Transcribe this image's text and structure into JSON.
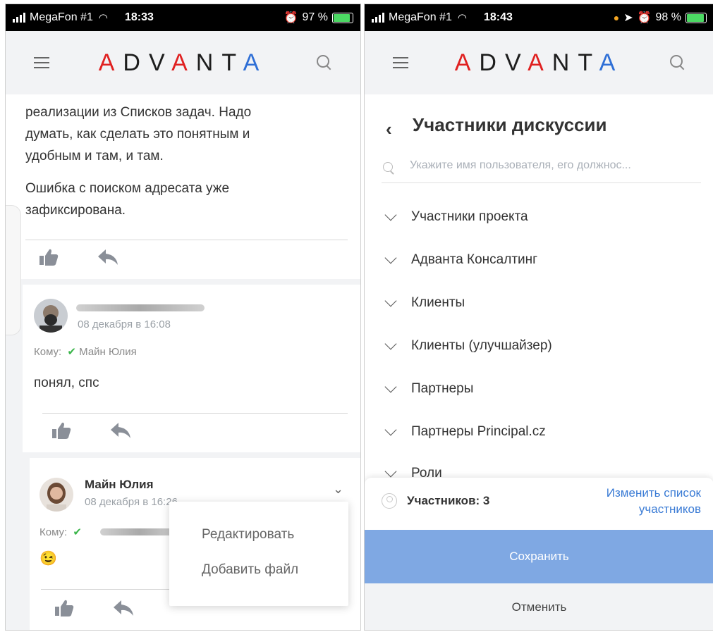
{
  "left_screen": {
    "status": {
      "carrier": "MegaFon #1",
      "time": "18:33",
      "battery": "97 %",
      "battery_level": 0.97
    },
    "logo": "ADVANTA",
    "comment1": {
      "text_lines": [
        "реализации из Списков задач. Надо",
        "думать, как сделать это понятным и",
        "удобным и там, и там."
      ],
      "text_2_lines": [
        "Ошибка с поиском адресата уже",
        "зафиксирована."
      ]
    },
    "comment2": {
      "date": "08 декабря в 16:08",
      "to_label": "Кому:",
      "to_name": "Майн Юлия",
      "check_icon": "check-icon",
      "text": "понял, спс"
    },
    "comment3": {
      "author": "Майн Юлия",
      "date": "08 декабря в 16:26",
      "to_label": "Кому:",
      "emoji": "😉"
    },
    "popup_menu": {
      "edit": "Редактировать",
      "add_file": "Добавить файл"
    },
    "icons": {
      "like": "thumbs-up-icon",
      "reply": "reply-icon",
      "menu": "menu-icon",
      "search": "search-icon"
    }
  },
  "right_screen": {
    "status": {
      "carrier": "MegaFon #1",
      "time": "18:43",
      "battery": "98 %",
      "battery_level": 0.98
    },
    "logo": "ADVANTA",
    "title": "Участники дискуссии",
    "search_placeholder": "Укажите имя пользователя, его должнос...",
    "groups": [
      "Участники проекта",
      "Адванта Консалтинг",
      "Клиенты",
      "Клиенты (улучшайзер)",
      "Партнеры",
      "Партнеры Principal.cz",
      "Роли"
    ],
    "participants_count": "Участников: 3",
    "change_list_line1": "Изменить список",
    "change_list_line2": "участников",
    "save": "Сохранить",
    "cancel": "Отменить"
  },
  "colors": {
    "accent_blue": "#3a7bd5",
    "save_button": "#7fa8e3",
    "logo_red": "#e02020",
    "logo_blue": "#2f6fd6",
    "check_green": "#3ab54a"
  }
}
